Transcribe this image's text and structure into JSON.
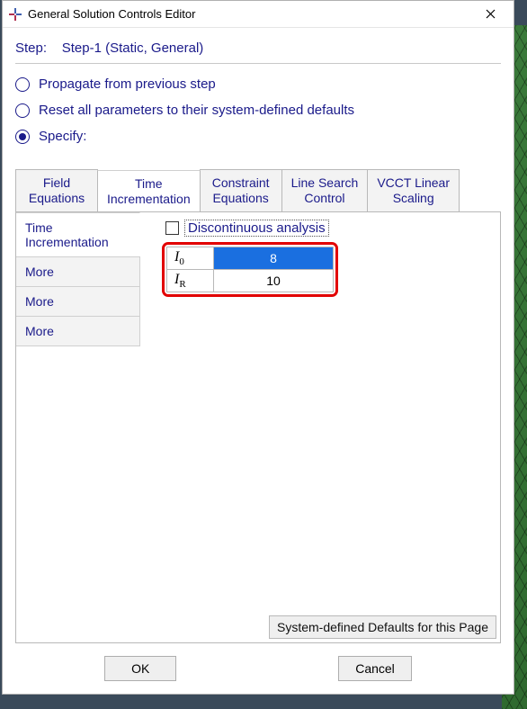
{
  "window": {
    "title": "General Solution Controls Editor"
  },
  "step": {
    "label": "Step:",
    "value": "Step-1 (Static, General)"
  },
  "options": {
    "propagate": "Propagate from previous step",
    "reset": "Reset all parameters to their system-defined defaults",
    "specify": "Specify:"
  },
  "tabs": {
    "field_equations": "Field\nEquations",
    "time_incrementation": "Time\nIncrementation",
    "constraint_equations": "Constraint\nEquations",
    "line_search_control": "Line Search\nControl",
    "vcct_linear_scaling": "VCCT Linear\nScaling"
  },
  "side_nav": {
    "time_incrementation": "Time\nIncrementation",
    "more1": "More",
    "more2": "More",
    "more3": "More"
  },
  "panel": {
    "discontinuous": "Discontinuous analysis",
    "params": {
      "I0": {
        "label": "I",
        "sub": "0",
        "value": "8"
      },
      "IR": {
        "label": "I",
        "sub": "R",
        "value": "10"
      }
    },
    "defaults_button": "System-defined Defaults for this Page"
  },
  "buttons": {
    "ok": "OK",
    "cancel": "Cancel"
  }
}
